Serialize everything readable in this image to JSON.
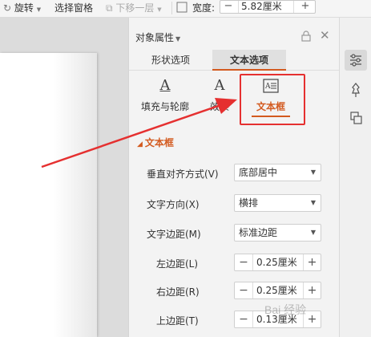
{
  "toolbar": {
    "rotate_label": "旋转",
    "selection_pane_label": "选择窗格",
    "move_down_label": "下移一层",
    "width_label": "宽度:",
    "width_value": "5.82厘米",
    "minus": "−",
    "plus": "+"
  },
  "panel": {
    "title": "对象属性",
    "tabs": [
      {
        "label": "形状选项",
        "active": false
      },
      {
        "label": "文本选项",
        "active": true
      }
    ],
    "sub_tabs": [
      {
        "label": "填充与轮廓",
        "icon": "text-fill-outline-icon",
        "active": false
      },
      {
        "label": "效果",
        "icon": "text-effect-icon",
        "active": false
      },
      {
        "label": "文本框",
        "icon": "textbox-icon",
        "active": true
      }
    ],
    "section": {
      "title": "文本框",
      "fields": {
        "vertical_align": {
          "label": "垂直对齐方式(V)",
          "value": "底部居中"
        },
        "text_direction": {
          "label": "文字方向(X)",
          "value": "横排"
        },
        "text_margin": {
          "label": "文字边距(M)",
          "value": "标准边距"
        },
        "left_margin": {
          "label": "左边距(L)",
          "value": "0.25厘米"
        },
        "right_margin": {
          "label": "右边距(R)",
          "value": "0.25厘米"
        },
        "top_margin": {
          "label": "上边距(T)",
          "value": "0.13厘米"
        }
      }
    }
  },
  "colors": {
    "accent": "#d35a1f",
    "highlight": "#e53030"
  }
}
